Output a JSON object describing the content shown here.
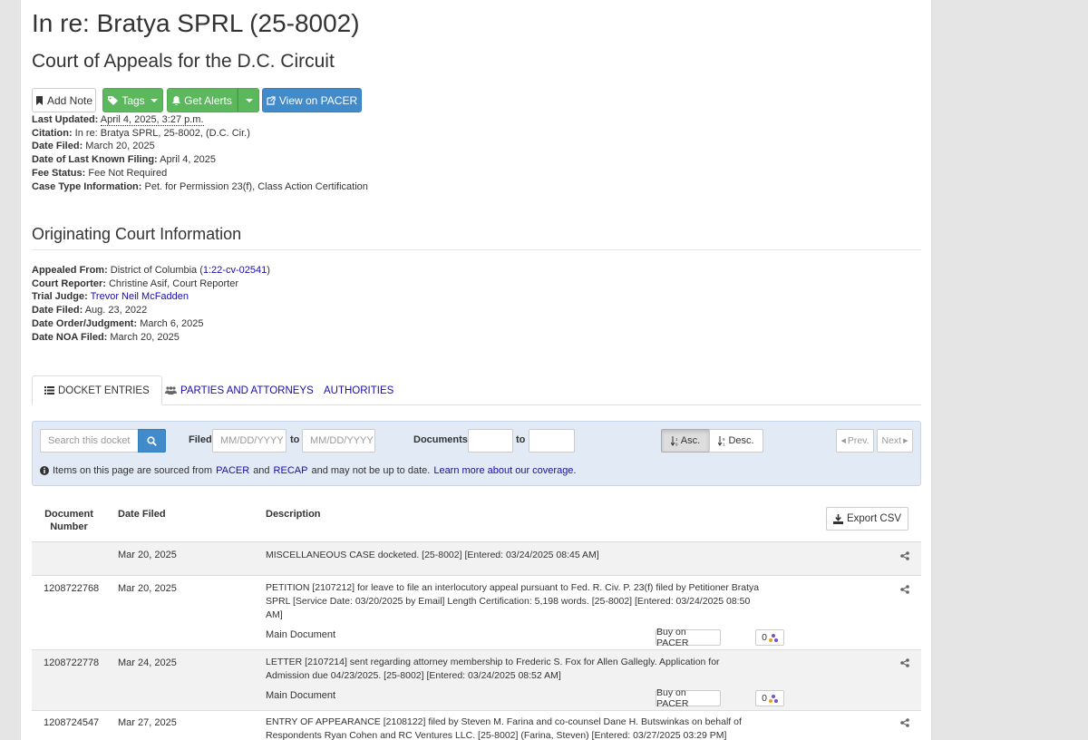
{
  "header": {
    "title": "In re: Bratya SPRL (25-8002)",
    "court": "Court of Appeals for the D.C. Circuit"
  },
  "toolbar": {
    "add_note": "Add Note",
    "tags": "Tags",
    "get_alerts": "Get Alerts",
    "view_pacer": "View on PACER"
  },
  "meta": {
    "last_updated_label": "Last Updated:",
    "last_updated": "April 4, 2025, 3:27 p.m.",
    "citation_label": "Citation:",
    "citation": "In re: Bratya SPRL, 25-8002, (D.C. Cir.)",
    "date_filed_label": "Date Filed:",
    "date_filed": "March 20, 2025",
    "last_filing_label": "Date of Last Known Filing:",
    "last_filing": "April 4, 2025",
    "fee_label": "Fee Status:",
    "fee": "Fee Not Required",
    "case_type_label": "Case Type Information:",
    "case_type": "Pet. for Permission 23(f), Class Action Certification"
  },
  "originating": {
    "heading": "Originating Court Information",
    "appealed_label": "Appealed From:",
    "appealed": "District of Columbia (",
    "appealed_link": "1:22-cv-02541",
    "appealed_close": ")",
    "reporter_label": "Court Reporter:",
    "reporter": "Christine Asif, Court Reporter",
    "judge_label": "Trial Judge:",
    "judge": "Trevor Neil McFadden",
    "filed_label": "Date Filed:",
    "filed": "Aug. 23, 2022",
    "order_label": "Date Order/Judgment:",
    "order": "March 6, 2025",
    "noa_label": "Date NOA Filed:",
    "noa": "March 20, 2025"
  },
  "tabs": [
    {
      "label": "DOCKET ENTRIES",
      "active": true
    },
    {
      "label": "PARTIES AND ATTORNEYS",
      "active": false
    },
    {
      "label": "AUTHORITIES",
      "active": false
    }
  ],
  "filters": {
    "search_placeholder": "Search this docket",
    "filed_label": "Filed",
    "date_placeholder": "MM/DD/YYYY",
    "to_label": "to",
    "documents_label": "Documents",
    "asc_label": "Asc.",
    "desc_label": "Desc.",
    "prev_label": "Prev.",
    "next_label": "Next",
    "notice_a": "Items on this page are sourced from",
    "notice_pacer": "PACER",
    "notice_and": "and",
    "notice_recap": "RECAP",
    "notice_b": "and may not be up to date.",
    "notice_link": "Learn more about our coverage."
  },
  "table": {
    "col_doc_1": "Document",
    "col_doc_2": "Number",
    "col_date": "Date Filed",
    "col_desc": "Description",
    "export": "Export CSV",
    "rows": [
      {
        "number": "",
        "date": "Mar 20, 2025",
        "description": "MISCELLANEOUS CASE docketed. [25-8002] [Entered: 03/24/2025 08:45 AM]"
      },
      {
        "number": "1208722768",
        "date": "Mar 20, 2025",
        "description": "PETITION [2107212] for leave to file an interlocutory appeal pursuant to Fed. R. Civ. P. 23(f) filed by Petitioner Bratya SPRL [Service Date: 03/20/2025 by Email] Length Certification: 5,198 words. [25-8002] [Entered: 03/24/2025 08:50 AM]",
        "doc_label": "Main Document",
        "buy": "Buy on PACER",
        "count": "0"
      },
      {
        "number": "1208722778",
        "date": "Mar 24, 2025",
        "description": "LETTER [2107214] sent regarding attorney membership to Frederic S. Fox for Allen Gallegly. Application for Admission due 04/23/2025. [25-8002] [Entered: 03/24/2025 08:52 AM]",
        "doc_label": "Main Document",
        "buy": "Buy on PACER",
        "count": "0"
      },
      {
        "number": "1208724547",
        "date": "Mar 27, 2025",
        "description": "ENTRY OF APPEARANCE [2108122] filed by Steven M. Farina and co-counsel Dane H. Butswinkas on behalf of Respondents Ryan Cohen and RC Ventures LLC. [25-8002] (Farina, Steven) [Entered: 03/27/2025 03:29 PM]"
      }
    ]
  },
  "colors": {
    "green": "#5cb85c",
    "blue": "#428bca",
    "link": "#1a0dab",
    "filter_bg": "#e1eaf5"
  }
}
